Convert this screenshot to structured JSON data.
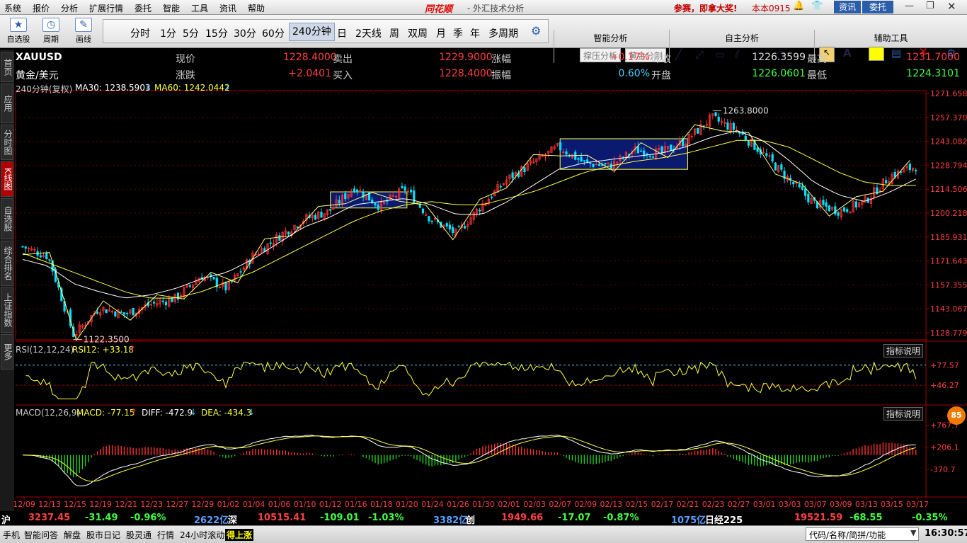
{
  "menu": [
    "系统",
    "报价",
    "分析",
    "扩展行情",
    "委托",
    "智能",
    "工具",
    "资讯",
    "帮助"
  ],
  "app": {
    "brand": "同花顺",
    "title": "- 外汇技术分析",
    "promo": "参赛，即拿大奖!",
    "version": "本本0915",
    "btn_news": "资讯",
    "btn_trade": "委托"
  },
  "toolbar": {
    "tools": [
      {
        "label": "自选股",
        "icon": "star-icon"
      },
      {
        "label": "周期",
        "icon": "clock-icon"
      },
      {
        "label": "画线",
        "icon": "pen-icon"
      }
    ],
    "periods": [
      "分时",
      "1分",
      "5分",
      "15分",
      "30分",
      "60分",
      "240分钟",
      "日",
      "2天线",
      "周",
      "双周",
      "月",
      "季",
      "年",
      "多周期"
    ],
    "selected_period": "240分钟",
    "smart_title": "智能分析",
    "smart_btns": [
      "撑压分析",
      "黄金分割"
    ],
    "self_title": "自主分析",
    "aux_title": "辅助工具"
  },
  "side_tabs": [
    "首页",
    "应用",
    "分时图",
    "K线图",
    "自选股",
    "综合排名",
    "上证指数",
    "更多"
  ],
  "active_side_tab": "K线图",
  "quote": {
    "symbol": "XAUUSD",
    "name": "黄金/美元",
    "r1": [
      {
        "l": "现价",
        "v": "1228.4000"
      },
      {
        "l": "卖出",
        "v": "1229.9000"
      },
      {
        "l": "涨幅",
        "v": "+0.17%"
      },
      {
        "l": "昨收",
        "v": "1226.3599"
      },
      {
        "l": "最高",
        "v": "1231.7000"
      }
    ],
    "r2": [
      {
        "l": "涨跌",
        "v": "+2.0401"
      },
      {
        "l": "买入",
        "v": "1228.4000"
      },
      {
        "l": "振幅",
        "v": "0.60%"
      },
      {
        "l": "开盘",
        "v": "1226.0601"
      },
      {
        "l": "最低",
        "v": "1224.3101"
      }
    ]
  },
  "indicators": {
    "main_header": "240分钟(复权)",
    "ma30": "MA30: 1238.5903",
    "ma60": "MA60: 1242.0442",
    "rsi_header": "RSI(12,12,24)",
    "rsi12": "RSI12: +33.18",
    "macd_header": "MACD(12,26,9)",
    "macd": "MACD: -77.15",
    "diff": "DIFF: -472.9",
    "dea": "DEA: -434.3",
    "explain": "指标说明",
    "high_label": "1263.8000",
    "low_label": "1122.3500",
    "price_axis": [
      "1271.6583",
      "1257.3705",
      "1243.0827",
      "1228.7949",
      "1214.5061",
      "1200.2183",
      "1185.9316",
      "1171.6438",
      "1157.3553",
      "1143.0674",
      "1128.7796"
    ],
    "rsi_axis": [
      "+77.57",
      "+46.27"
    ],
    "macd_axis": [
      "+767.7",
      "+206.1",
      "-370.7"
    ],
    "badge": "85"
  },
  "chart_data": {
    "type": "candlestick",
    "x_dates": [
      "12/09",
      "12/13",
      "12/15",
      "12/19",
      "12/21",
      "12/23",
      "12/27",
      "12/29",
      "01/02",
      "01/04",
      "01/06",
      "01/10",
      "01/12",
      "01/16",
      "01/18",
      "01/20",
      "01/24",
      "01/26",
      "01/30",
      "02/01",
      "02/03",
      "02/07",
      "02/09",
      "02/13",
      "02/15",
      "02/17",
      "02/21",
      "02/23",
      "02/27",
      "03/01",
      "03/03",
      "03/07",
      "03/09",
      "03/13",
      "03/15",
      "03/17"
    ],
    "ylim": [
      1121,
      1274
    ],
    "close_anchors": [
      1178,
      1172,
      1123,
      1140,
      1136,
      1142,
      1146,
      1160,
      1152,
      1172,
      1184,
      1195,
      1200,
      1215,
      1203,
      1214,
      1195,
      1186,
      1204,
      1220,
      1230,
      1240,
      1230,
      1228,
      1238,
      1236,
      1244,
      1258,
      1250,
      1236,
      1220,
      1205,
      1200,
      1206,
      1222,
      1228
    ],
    "ma_short_anchors": [
      1170,
      1166,
      1155,
      1150,
      1146,
      1148,
      1152,
      1158,
      1162,
      1170,
      1180,
      1190,
      1196,
      1204,
      1206,
      1208,
      1204,
      1198,
      1198,
      1206,
      1216,
      1226,
      1230,
      1232,
      1234,
      1236,
      1240,
      1246,
      1250,
      1244,
      1232,
      1218,
      1210,
      1206,
      1212,
      1220
    ],
    "ma_long_anchors": [
      1174,
      1168,
      1162,
      1156,
      1150,
      1146,
      1146,
      1150,
      1156,
      1162,
      1170,
      1178,
      1186,
      1194,
      1200,
      1204,
      1206,
      1204,
      1204,
      1208,
      1212,
      1218,
      1224,
      1228,
      1231,
      1233,
      1236,
      1240,
      1244,
      1244,
      1240,
      1232,
      1224,
      1218,
      1216,
      1216
    ],
    "boxes": [
      {
        "x1": "01/12",
        "x2": "01/20",
        "ylo": 1202,
        "yhi": 1212
      },
      {
        "x1": "02/07",
        "x2": "02/21",
        "ylo": 1226,
        "yhi": 1245
      }
    ],
    "rsi_ylim": [
      20,
      95
    ],
    "rsi_levels": [
      77.57,
      46.27
    ],
    "macd_ylim": [
      -900,
      1000
    ]
  },
  "status_bar": [
    {
      "t": "沪",
      "c": "#fff"
    },
    {
      "t": "3237.45",
      "c": "#ff4040"
    },
    {
      "t": "-31.49",
      "c": "#40ff40"
    },
    {
      "t": "-0.96%",
      "c": "#40ff40"
    },
    {
      "t": "2622亿",
      "c": "#5aa0ff"
    },
    {
      "t": "深",
      "c": "#fff"
    },
    {
      "t": "10515.41",
      "c": "#ff4040"
    },
    {
      "t": "-109.01",
      "c": "#40ff40"
    },
    {
      "t": "-1.03%",
      "c": "#40ff40"
    },
    {
      "t": "3382亿",
      "c": "#5aa0ff"
    },
    {
      "t": "创",
      "c": "#fff"
    },
    {
      "t": "1949.66",
      "c": "#ff4040"
    },
    {
      "t": "-17.07",
      "c": "#40ff40"
    },
    {
      "t": "-0.87%",
      "c": "#40ff40"
    },
    {
      "t": "1075亿",
      "c": "#5aa0ff"
    },
    {
      "t": "日经225",
      "c": "#fff"
    },
    {
      "t": "19521.59",
      "c": "#ff4040"
    },
    {
      "t": "-68.55",
      "c": "#40ff40"
    },
    {
      "t": "-0.35%",
      "c": "#40ff40"
    }
  ],
  "taskbar": {
    "items": [
      "手机",
      "智能问答",
      "解盘",
      "股市日记",
      "股灵通",
      "行情",
      "24小时滚动"
    ],
    "highlight": "得上涨",
    "search": "代码/名称/简拼/功能",
    "time": "16:30:57"
  }
}
